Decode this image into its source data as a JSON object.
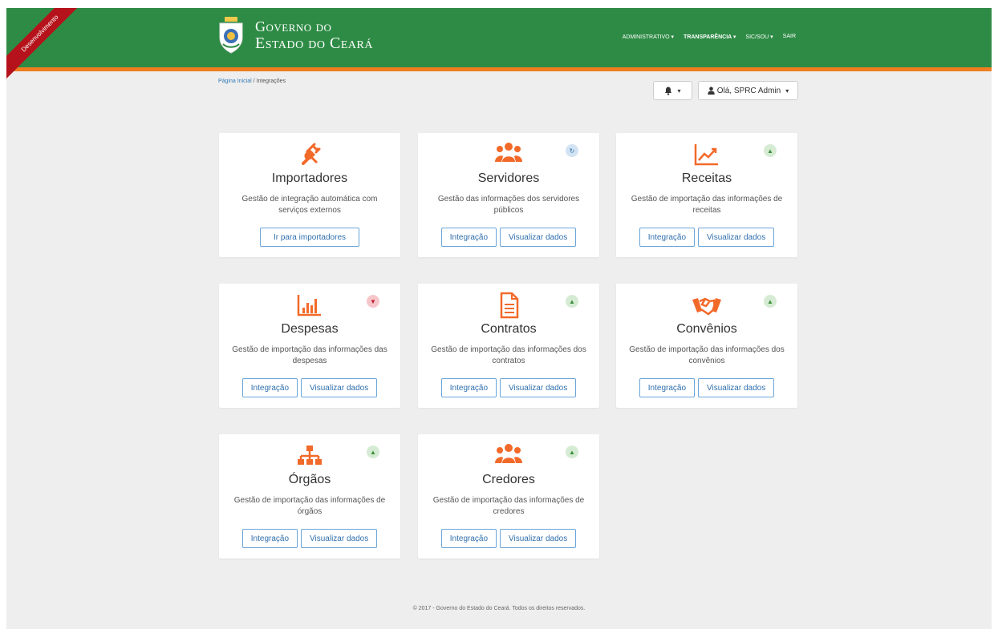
{
  "colors": {
    "header_green": "#2e8b45",
    "accent_orange": "#f07d1f",
    "ribbon_red": "#b5121b",
    "link_blue": "#337ab7"
  },
  "ribbon": {
    "label": "Desenvolvimento"
  },
  "brand": {
    "line1": "Governo do",
    "line2": "Estado do Ceará"
  },
  "nav": {
    "items": [
      {
        "label": "ADMINISTRATIVO ▾"
      },
      {
        "label": "TRANSPARÊNCIA ▾"
      },
      {
        "label": "SIC/SOU ▾"
      },
      {
        "label": "SAIR"
      }
    ]
  },
  "breadcrumb": {
    "home": "Página Inicial",
    "separator": "/",
    "current": "Integrações"
  },
  "toolbar": {
    "bell_caret": "▾",
    "user_label": "Olá, SPRC Admin",
    "user_caret": "▾"
  },
  "cards": [
    {
      "icon": "plug-icon",
      "status": "",
      "title": "Importadores",
      "desc": "Gestão de integração automática com serviços externos",
      "buttons": [
        "Ir para importadores"
      ]
    },
    {
      "icon": "users-icon",
      "status": "sync",
      "title": "Servidores",
      "desc": "Gestão das informações dos servidores públicos",
      "buttons": [
        "Integração",
        "Visualizar dados"
      ]
    },
    {
      "icon": "line-chart-icon",
      "status": "ok",
      "title": "Receitas",
      "desc": "Gestão de importação das informações de receitas",
      "buttons": [
        "Integração",
        "Visualizar dados"
      ]
    },
    {
      "icon": "bar-chart-icon",
      "status": "bad",
      "title": "Despesas",
      "desc": "Gestão de importação das informações das despesas",
      "buttons": [
        "Integração",
        "Visualizar dados"
      ]
    },
    {
      "icon": "document-icon",
      "status": "ok",
      "title": "Contratos",
      "desc": "Gestão de importação das informações dos contratos",
      "buttons": [
        "Integração",
        "Visualizar dados"
      ]
    },
    {
      "icon": "handshake-icon",
      "status": "ok",
      "title": "Convênios",
      "desc": "Gestão de importação das informações dos convênios",
      "buttons": [
        "Integração",
        "Visualizar dados"
      ]
    },
    {
      "icon": "org-chart-icon",
      "status": "ok",
      "title": "Órgãos",
      "desc": "Gestão de importação das informações de órgãos",
      "buttons": [
        "Integração",
        "Visualizar dados"
      ]
    },
    {
      "icon": "users-icon",
      "status": "ok",
      "title": "Credores",
      "desc": "Gestão de importação das informações de credores",
      "buttons": [
        "Integração",
        "Visualizar dados"
      ]
    }
  ],
  "footer": {
    "text": "© 2017 - Governo do Estado do Ceará. Todos os direitos reservados."
  }
}
